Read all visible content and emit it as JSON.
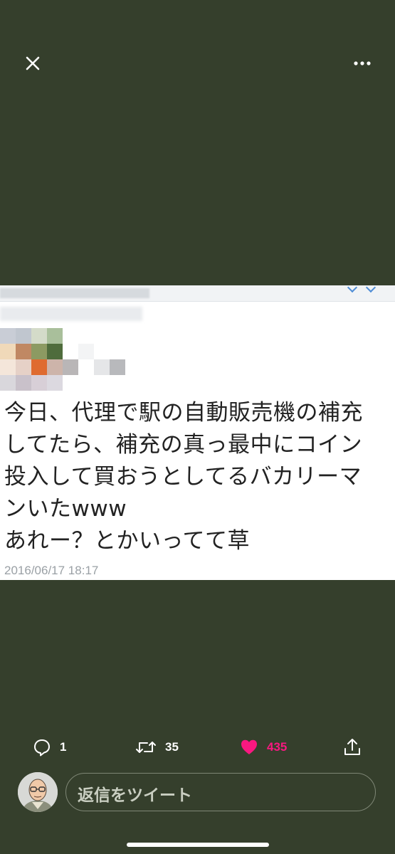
{
  "colors": {
    "background": "#353f2c",
    "like_accent": "#f91880",
    "icon": "#ffffff"
  },
  "topbar": {
    "close_icon": "close-icon",
    "more_icon": "more-horizontal-icon"
  },
  "post": {
    "lines": [
      "今日、代理で駅の自動販売機の補充",
      "してたら、補充の真っ最中にコイン",
      "投入して買おうとしてるバカリーマ",
      "ンいたwww",
      "あれー？とかいってて草"
    ],
    "date": "2016/06/17 18:17"
  },
  "actions": {
    "reply_count": "1",
    "retweet_count": "35",
    "like_count": "435",
    "reply_icon": "reply-bubble-icon",
    "retweet_icon": "retweet-icon",
    "like_icon": "heart-icon",
    "share_icon": "share-icon"
  },
  "reply": {
    "placeholder": "返信をツイート"
  }
}
